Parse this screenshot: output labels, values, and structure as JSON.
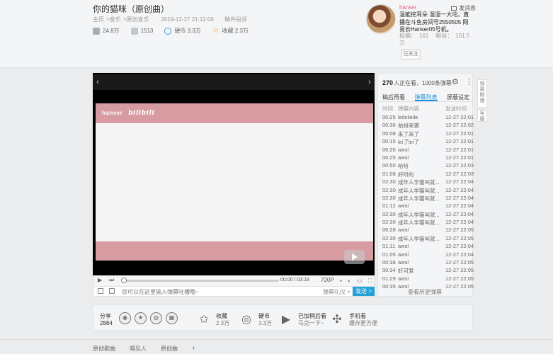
{
  "video": {
    "title": "你的猫咪（原创曲）",
    "breadcrumb": [
      "主页",
      ">音乐",
      ">原创音乐"
    ],
    "date": "2019-12-27 21:12:06",
    "report": "稿件投诉",
    "stats": {
      "plays": "24.8万",
      "danmaku": "1513",
      "coins": "硬币 3.3万",
      "favorites": "收藏 2.3万"
    }
  },
  "uploader": {
    "name": "hanser",
    "message_label": "发消息",
    "desc": "温能挖耳朵 湿湿一大坨。直播在斗鱼房间号2550505 网易云Hanser05号机。",
    "submissions_label": "投稿：",
    "submissions": "161",
    "fans_label": "粉丝：",
    "fans": "151.5万",
    "follow_label": "已关注"
  },
  "player": {
    "brand_text": "hanser",
    "brand_logo": "bilibili",
    "time": "00:00 / 03:18",
    "quality": "720P",
    "progress": 0.0,
    "danmaku_placeholder": "您可以在这里输入弹幕吐槽哦~",
    "danmaku_gift": "弹幕礼仪 >",
    "send_label": "发送 >"
  },
  "sidebar": {
    "online_count": "270",
    "online_text": "人正在看，1000条弹幕",
    "tabs": [
      "稿后再看",
      "弹幕列表",
      "屏蔽设定"
    ],
    "active_tab": 1,
    "columns": [
      "时间",
      "弹幕内容",
      "发送时间"
    ],
    "rows": [
      {
        "t": "00:25",
        "c": "leileileile",
        "d": "12-27 22:01"
      },
      {
        "t": "00:36",
        "c": "前排来袭",
        "d": "12-27 22:02"
      },
      {
        "t": "00:08",
        "c": "来了来了",
        "d": "12-27 22:01"
      },
      {
        "t": "00:15",
        "c": "lei了lei了",
        "d": "12-27 22:01"
      },
      {
        "t": "00:26",
        "c": "awsl",
        "d": "12-27 22:01"
      },
      {
        "t": "00:25",
        "c": "awsl",
        "d": "12-27 22:01"
      },
      {
        "t": "00:50",
        "c": "哈哈",
        "d": "12-27 22:03"
      },
      {
        "t": "01:08",
        "c": "好听的",
        "d": "12-27 22:03"
      },
      {
        "t": "02:30",
        "c": "成年人学猫叫就...",
        "d": "12-27 22:04"
      },
      {
        "t": "02:30",
        "c": "成年人学猫叫就...",
        "d": "12-27 22:04"
      },
      {
        "t": "02:30",
        "c": "成年人学猫叫就...",
        "d": "12-27 22:04"
      },
      {
        "t": "01:12",
        "c": "awsl",
        "d": "12-27 22:04"
      },
      {
        "t": "02:30",
        "c": "成年人学猫叫就...",
        "d": "12-27 22:04"
      },
      {
        "t": "02:30",
        "c": "成年人学猫叫就...",
        "d": "12-27 22:04"
      },
      {
        "t": "00:28",
        "c": "awsl",
        "d": "12-27 22:05"
      },
      {
        "t": "02:30",
        "c": "成年人学猫叫就...",
        "d": "12-27 22:05"
      },
      {
        "t": "01:11",
        "c": "awsl",
        "d": "12-27 22:04"
      },
      {
        "t": "01:05",
        "c": "awsl",
        "d": "12-27 22:04"
      },
      {
        "t": "00:38",
        "c": "awsl",
        "d": "12-27 22:05"
      },
      {
        "t": "00:34",
        "c": "好可爱",
        "d": "12-27 22:05"
      },
      {
        "t": "01:29",
        "c": "awsl",
        "d": "12-27 22:05"
      },
      {
        "t": "00:35",
        "c": "awsl",
        "d": "12-27 22:05"
      }
    ],
    "history_label": "查看历史弹幕"
  },
  "right_tabs": [
    "弹幕联播",
    "客服"
  ],
  "share": {
    "label": "分享",
    "count": "2884",
    "actions": [
      {
        "label": "收藏",
        "sub": "2.3万"
      },
      {
        "label": "硬币",
        "sub": "3.3万"
      },
      {
        "label": "已加稍后看",
        "sub": "马克一下~"
      },
      {
        "label": "手机看",
        "sub": "缓存更方便"
      }
    ]
  },
  "tags": [
    "原创歌曲",
    "唱见人",
    "原创曲",
    "+"
  ]
}
